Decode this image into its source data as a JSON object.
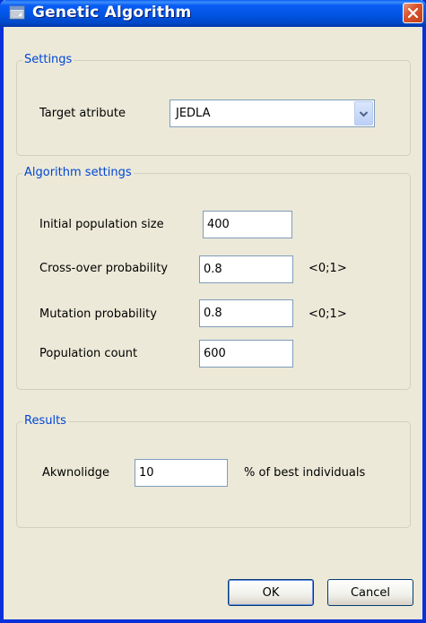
{
  "window": {
    "title": "Genetic Algorithm"
  },
  "settings": {
    "legend": "Settings",
    "target_label": "Target atribute",
    "target_value": "JEDLA"
  },
  "algorithm": {
    "legend": "Algorithm settings",
    "fields": [
      {
        "label": "Initial population size",
        "value": "400",
        "hint": ""
      },
      {
        "label": "Cross-over probability",
        "value": "0.8",
        "hint": "<0;1>"
      },
      {
        "label": "Mutation probability",
        "value": "0.8",
        "hint": "<0;1>"
      },
      {
        "label": "Population count",
        "value": "600",
        "hint": ""
      }
    ]
  },
  "results": {
    "legend": "Results",
    "label": "Akwnolidge",
    "value": "10",
    "suffix": "% of best individuals"
  },
  "buttons": {
    "ok": "OK",
    "cancel": "Cancel"
  },
  "colors": {
    "titlebar": "#0054e3",
    "legend_text": "#0046d5",
    "close_button": "#d8552e"
  }
}
